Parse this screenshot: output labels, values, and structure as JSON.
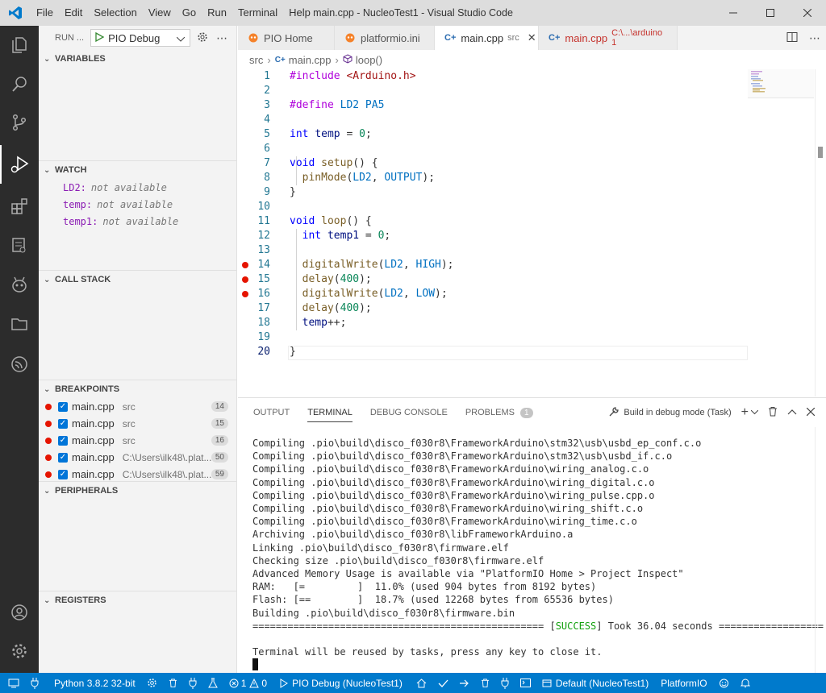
{
  "window": {
    "title": "main.cpp - NucleoTest1 - Visual Studio Code",
    "menu": [
      "File",
      "Edit",
      "Selection",
      "View",
      "Go",
      "Run",
      "Terminal",
      "Help"
    ]
  },
  "sidebar": {
    "run_label": "RUN ...",
    "config": "PIO Debug",
    "sections": {
      "variables": "VARIABLES",
      "watch": "WATCH",
      "call_stack": "CALL STACK",
      "breakpoints": "BREAKPOINTS",
      "peripherals": "PERIPHERALS",
      "registers": "REGISTERS"
    },
    "watch": [
      {
        "name": "LD2:",
        "value": "not available"
      },
      {
        "name": "temp:",
        "value": "not available"
      },
      {
        "name": "temp1:",
        "value": "not available"
      }
    ],
    "breakpoints": [
      {
        "file": "main.cpp",
        "path": "src",
        "line": "14"
      },
      {
        "file": "main.cpp",
        "path": "src",
        "line": "15"
      },
      {
        "file": "main.cpp",
        "path": "src",
        "line": "16"
      },
      {
        "file": "main.cpp",
        "path": "C:\\Users\\ilk48\\.plat...",
        "line": "50"
      },
      {
        "file": "main.cpp",
        "path": "C:\\Users\\ilk48\\.plat...",
        "line": "59"
      }
    ]
  },
  "tabs": [
    {
      "label": "PIO Home",
      "sub": ""
    },
    {
      "label": "platformio.ini",
      "sub": ""
    },
    {
      "label": "main.cpp",
      "sub": "src"
    },
    {
      "label": "main.cpp",
      "sub": "C:\\...\\arduino 1"
    }
  ],
  "breadcrumb": [
    "src",
    "main.cpp",
    "loop()"
  ],
  "editor": {
    "line_numbers": [
      "1",
      "2",
      "3",
      "4",
      "5",
      "6",
      "7",
      "8",
      "9",
      "10",
      "11",
      "12",
      "13",
      "14",
      "15",
      "16",
      "17",
      "18",
      "19",
      "20"
    ],
    "code": {
      "l1_a": "#include ",
      "l1_b": "<Arduino.h>",
      "l3_a": "#define ",
      "l3_b": "LD2 PA5",
      "l5_a": "int ",
      "l5_b": "temp",
      "l5_c": " = ",
      "l5_d": "0",
      "l5_e": ";",
      "l7_a": "void ",
      "l7_b": "setup",
      "l7_c": "() {",
      "l8_a": "pinMode",
      "l8_b": "(",
      "l8_c": "LD2",
      "l8_d": ", ",
      "l8_e": "OUTPUT",
      "l8_f": ");",
      "l9": "}",
      "l11_a": "void ",
      "l11_b": "loop",
      "l11_c": "() {",
      "l12_a": "int ",
      "l12_b": "temp1",
      "l12_c": " = ",
      "l12_d": "0",
      "l12_e": ";",
      "l14_a": "digitalWrite",
      "l14_b": "(",
      "l14_c": "LD2",
      "l14_d": ", ",
      "l14_e": "HIGH",
      "l14_f": ");",
      "l15_a": "delay",
      "l15_b": "(",
      "l15_c": "400",
      "l15_d": ");",
      "l16_a": "digitalWrite",
      "l16_b": "(",
      "l16_c": "LD2",
      "l16_d": ", ",
      "l16_e": "LOW",
      "l16_f": ");",
      "l17_a": "delay",
      "l17_b": "(",
      "l17_c": "400",
      "l17_d": ");",
      "l18_a": "temp",
      "l18_b": "++;",
      "l20": "}"
    }
  },
  "panel": {
    "tabs": [
      "OUTPUT",
      "TERMINAL",
      "DEBUG CONSOLE",
      "PROBLEMS"
    ],
    "problems_count": "1",
    "task": "Build in debug mode (Task)",
    "terminal_lines": [
      "Compiling .pio\\build\\disco_f030r8\\FrameworkArduino\\stm32\\usb\\usbd_ep_conf.c.o",
      "Compiling .pio\\build\\disco_f030r8\\FrameworkArduino\\stm32\\usb\\usbd_if.c.o",
      "Compiling .pio\\build\\disco_f030r8\\FrameworkArduino\\wiring_analog.c.o",
      "Compiling .pio\\build\\disco_f030r8\\FrameworkArduino\\wiring_digital.c.o",
      "Compiling .pio\\build\\disco_f030r8\\FrameworkArduino\\wiring_pulse.cpp.o",
      "Compiling .pio\\build\\disco_f030r8\\FrameworkArduino\\wiring_shift.c.o",
      "Compiling .pio\\build\\disco_f030r8\\FrameworkArduino\\wiring_time.c.o",
      "Archiving .pio\\build\\disco_f030r8\\libFrameworkArduino.a",
      "Linking .pio\\build\\disco_f030r8\\firmware.elf",
      "Checking size .pio\\build\\disco_f030r8\\firmware.elf",
      "Advanced Memory Usage is available via \"PlatformIO Home > Project Inspect\"",
      "RAM:   [=         ]  11.0% (used 904 bytes from 8192 bytes)",
      "Flash: [==        ]  18.7% (used 12268 bytes from 65536 bytes)",
      "Building .pio\\build\\disco_f030r8\\firmware.bin"
    ],
    "success_left": "================================================== [",
    "success_word": "SUCCESS",
    "success_right": "] Took 36.04 seconds ==================",
    "reuse_msg": "Terminal will be reused by tasks, press any key to close it."
  },
  "statusbar": {
    "python": "Python 3.8.2 32-bit",
    "errors": "1",
    "warnings": "0",
    "debug": "PIO Debug (NucleoTest1)",
    "env": "Default (NucleoTest1)",
    "platformio": "PlatformIO"
  },
  "colors": {
    "accent": "#007acc",
    "breakpoint": "#e51400",
    "success": "#13a10e"
  }
}
